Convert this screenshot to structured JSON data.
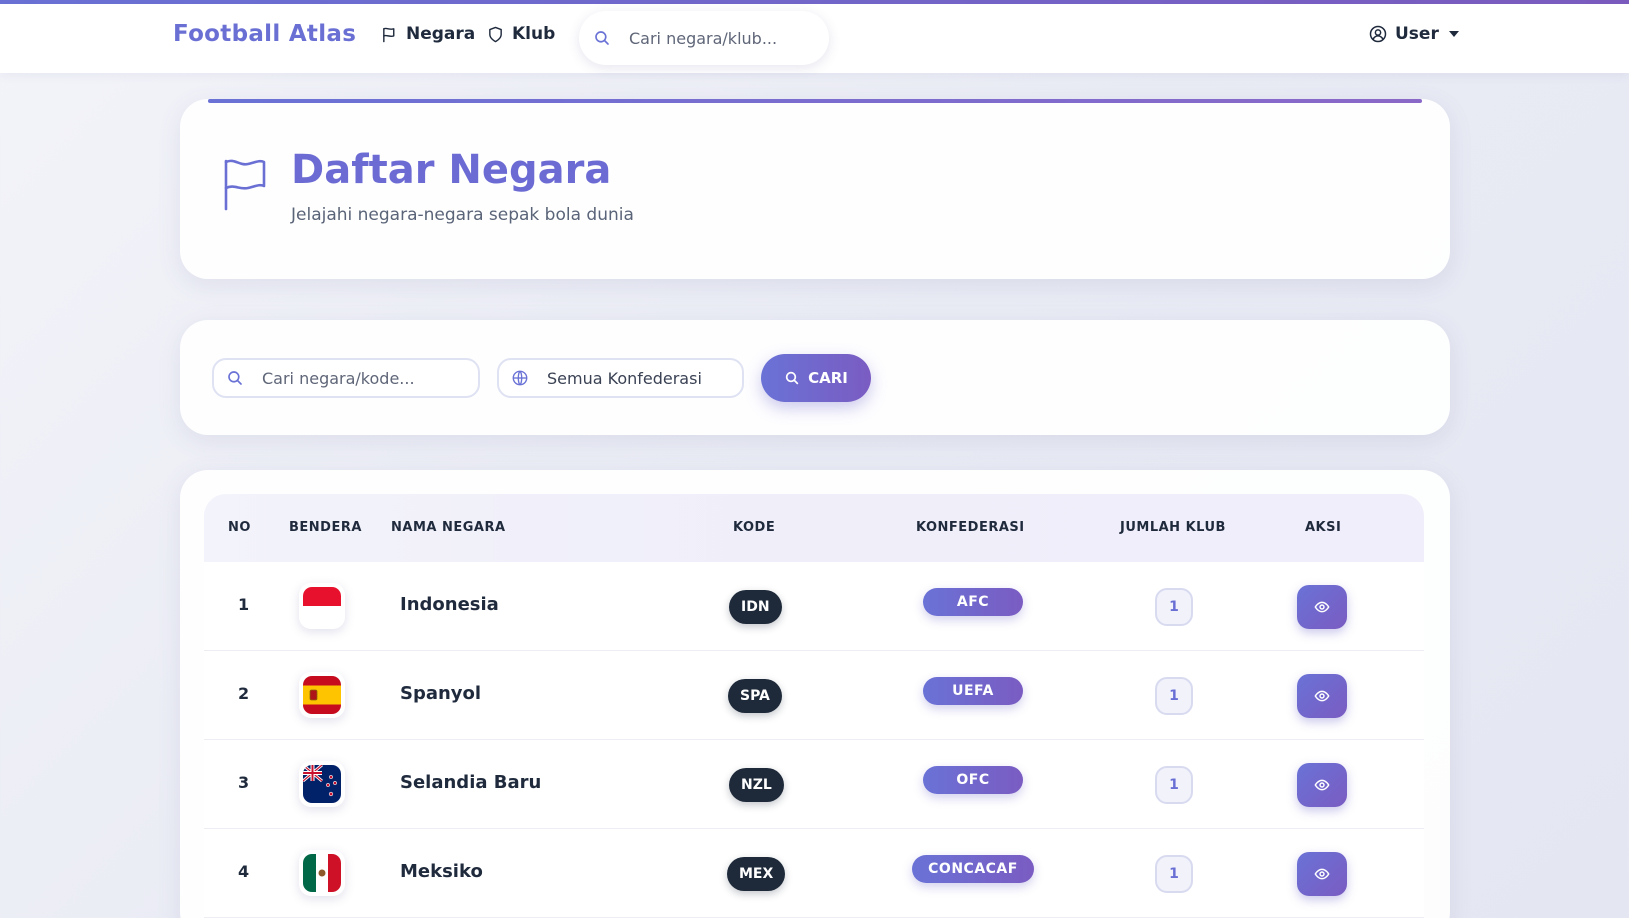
{
  "navbar": {
    "brand": "Football Atlas",
    "links": [
      {
        "label": "Negara",
        "icon": "flag-icon"
      },
      {
        "label": "Klub",
        "icon": "shield-icon"
      }
    ],
    "search_placeholder": "Cari negara/klub...",
    "user_label": "User"
  },
  "header": {
    "title": "Daftar Negara",
    "subtitle": "Jelajahi negara-negara sepak bola dunia"
  },
  "filters": {
    "search_placeholder": "Cari negara/kode...",
    "confederation_value": "Semua Konfederasi",
    "search_button": "CARI"
  },
  "table": {
    "columns": [
      "NO",
      "BENDERA",
      "NAMA NEGARA",
      "KODE",
      "KONFEDERASI",
      "JUMLAH KLUB",
      "AKSI"
    ],
    "rows": [
      {
        "no": "1",
        "flag": "indonesia",
        "name": "Indonesia",
        "code": "IDN",
        "confederation": "AFC",
        "clubs": "1"
      },
      {
        "no": "2",
        "flag": "spain",
        "name": "Spanyol",
        "code": "SPA",
        "confederation": "UEFA",
        "clubs": "1"
      },
      {
        "no": "3",
        "flag": "new-zealand",
        "name": "Selandia Baru",
        "code": "NZL",
        "confederation": "OFC",
        "clubs": "1"
      },
      {
        "no": "4",
        "flag": "mexico",
        "name": "Meksiko",
        "code": "MEX",
        "confederation": "CONCACAF",
        "clubs": "1"
      }
    ]
  },
  "colors": {
    "accent": "#6a6fd4",
    "accent_purple": "#7a5cc2",
    "code_pill": "#1e2a3a",
    "text": "#1f2a3d"
  }
}
